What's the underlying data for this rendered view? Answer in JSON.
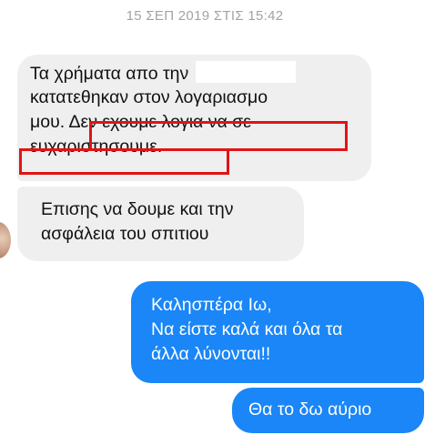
{
  "timestamp": "15 ΣΕΠ 2019 ΣΤΙΣ 15:42",
  "messages": [
    {
      "direction": "incoming",
      "lines": [
        "Τα χρήματα απο την",
        "κατατεθηκαν στον λογαριασμο",
        "μου. Δεν εχουμε λογια να σε",
        "ευχαριστησουμε."
      ],
      "partial_text": "general",
      "redacted": true
    },
    {
      "direction": "incoming",
      "lines": [
        "Επισης να δουμε και την",
        "ασφάλεια του σπιτιου"
      ]
    },
    {
      "direction": "outgoing",
      "lines": [
        "Καλησπέρα Ιω,",
        "Να είστε καλά και όλα τα",
        "άλλα λύνονται!!"
      ]
    },
    {
      "direction": "outgoing",
      "lines": [
        "Θα το δω αύριο"
      ]
    }
  ],
  "highlight_color": "#e11414",
  "colors": {
    "outgoing_bubble": "#1a86f7",
    "incoming_bubble": "#efefef",
    "timestamp_text": "#a3a3a3"
  },
  "icons": {
    "sender_avatar": "avatar-photo"
  }
}
